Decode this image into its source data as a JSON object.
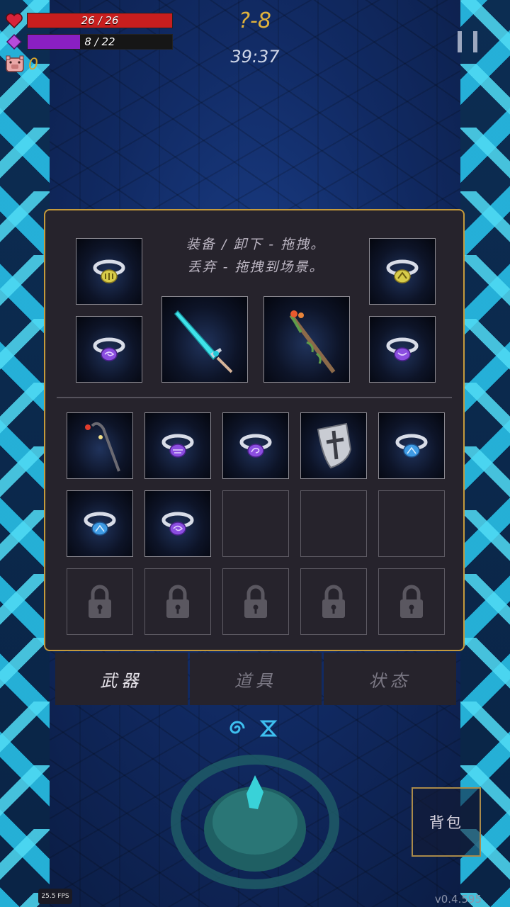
{
  "hud": {
    "hp_text": "26 / 26",
    "hp_fraction": 1.0,
    "mp_text": "8 / 22",
    "mp_fraction": 0.364,
    "coins": "0",
    "level": "?-8",
    "timer": "39:37",
    "hp_color": "#c81e1e",
    "mp_color": "#8a1fc2",
    "heart_icon": "heart-icon",
    "mana_icon": "diamond-icon",
    "coin_icon": "pig-icon",
    "pause_icon": "pause-icon"
  },
  "inventory": {
    "hint_line1": "装备 / 卸下 - 拖拽。",
    "hint_line2": "丢弃 - 拖拽到场景。",
    "equipped": {
      "ring_top_left": "yellow-ring",
      "ring_bottom_left": "purple-ring",
      "weapon_left": "cyan-sword",
      "weapon_right": "wooden-staff",
      "ring_top_right": "yellow-ring",
      "ring_bottom_right": "purple-ring"
    },
    "bag": [
      "dark-staff",
      "purple-ring",
      "purple-ring",
      "shield",
      "blue-ring",
      "blue-ring",
      "purple-ring",
      "",
      "",
      "",
      "locked",
      "locked",
      "locked",
      "locked",
      "locked"
    ]
  },
  "tabs": {
    "weapons": "武器",
    "items": "道具",
    "status": "状态"
  },
  "backpack_label": "背包",
  "fps": "25.5 FPS",
  "version": "v0.4.595"
}
